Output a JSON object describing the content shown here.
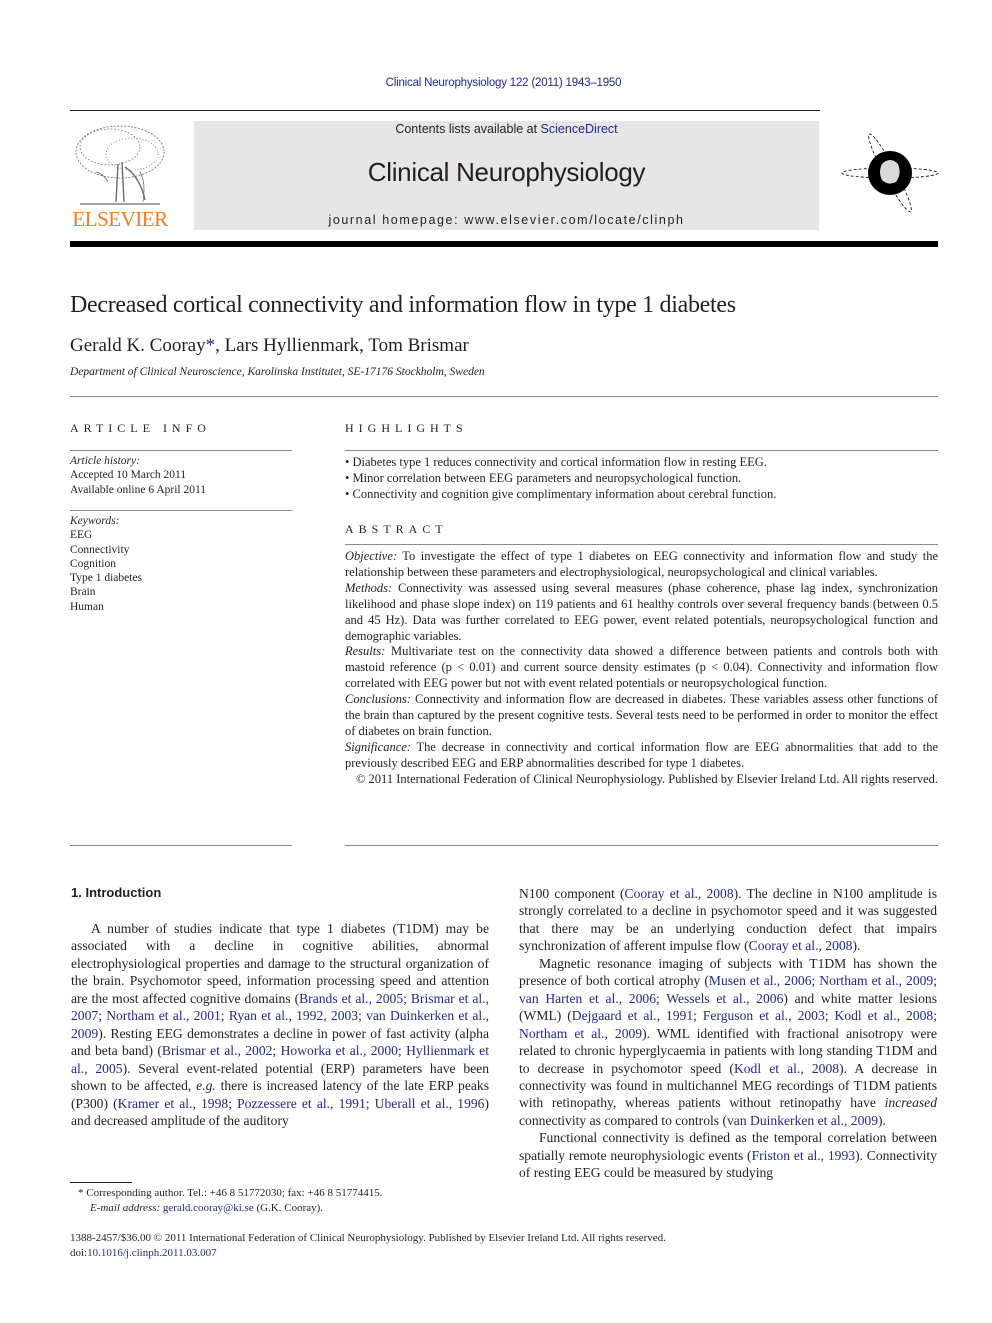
{
  "header": {
    "running_head": "Clinical Neurophysiology 122 (2011) 1943–1950",
    "contents_prefix": "Contents lists available at ",
    "contents_link": "ScienceDirect",
    "journal_title": "Clinical Neurophysiology",
    "homepage_line": "journal homepage: www.elsevier.com/locate/clinph",
    "publisher_logo_text": "ELSEVIER",
    "colors": {
      "link": "#1f2a8a",
      "elsevier_orange": "#f47b20",
      "masthead_bg": "#e6e6e6"
    }
  },
  "article": {
    "title": "Decreased cortical connectivity and information flow in type 1 diabetes",
    "authors": [
      {
        "name": "Gerald K. Cooray",
        "mark": "*"
      },
      {
        "name": "Lars Hyllienmark"
      },
      {
        "name": "Tom Brismar"
      }
    ],
    "authors_sep1": ", ",
    "authors_sep2": ", ",
    "affiliation": "Department of Clinical Neuroscience, Karolinska Institutet, SE-17176 Stockholm, Sweden"
  },
  "article_info": {
    "heading": "ARTICLE INFO",
    "history_label": "Article history:",
    "history": [
      "Accepted 10 March 2011",
      "Available online 6 April 2011"
    ],
    "keywords_label": "Keywords:",
    "keywords": [
      "EEG",
      "Connectivity",
      "Cognition",
      "Type 1 diabetes",
      "Brain",
      "Human"
    ]
  },
  "highlights": {
    "heading": "HIGHLIGHTS",
    "items": [
      "• Diabetes type 1 reduces connectivity and cortical information flow in resting EEG.",
      "• Minor correlation between EEG parameters and neuropsychological function.",
      "• Connectivity and cognition give complimentary information about cerebral function."
    ]
  },
  "abstract": {
    "heading": "ABSTRACT",
    "sections": [
      {
        "label": "Objective:",
        "text": " To investigate the effect of type 1 diabetes on EEG connectivity and information flow and study the relationship between these parameters and electrophysiological, neuropsychological and clinical variables."
      },
      {
        "label": "Methods:",
        "text": " Connectivity was assessed using several measures (phase coherence, phase lag index, synchronization likelihood and phase slope index) on 119 patients and 61 healthy controls over several frequency bands (between 0.5 and 45 Hz). Data was further correlated to EEG power, event related potentials, neuropsychological function and demographic variables."
      },
      {
        "label": "Results:",
        "text": " Multivariate test on the connectivity data showed a difference between patients and controls both with mastoid reference (p < 0.01) and current source density estimates (p < 0.04). Connectivity and information flow correlated with EEG power but not with event related potentials or neuropsychological function."
      },
      {
        "label": "Conclusions:",
        "text": " Connectivity and information flow are decreased in diabetes. These variables assess other functions of the brain than captured by the present cognitive tests. Several tests need to be performed in order to monitor the effect of diabetes on brain function."
      },
      {
        "label": "Significance:",
        "text": " The decrease in connectivity and cortical information flow are EEG abnormalities that add to the previously described EEG and ERP abnormalities described for type 1 diabetes."
      }
    ],
    "copyright": "© 2011 International Federation of Clinical Neurophysiology. Published by Elsevier Ireland Ltd. All rights reserved."
  },
  "body": {
    "section_heading": "1. Introduction",
    "left_col": {
      "p1": [
        {
          "t": "A number of studies indicate that type 1 diabetes (T1DM) may be associated with a decline in cognitive abilities, abnormal electrophysiological properties and damage to the structural organization of the brain. Psychomotor speed, information processing speed and attention are the most affected cognitive domains ("
        },
        {
          "link": "Brands et al., 2005; Brismar et al., 2007; Northam et al., 2001; Ryan et al., 1992, 2003; van Duinkerken et al., 2009"
        },
        {
          "t": "). Resting EEG demonstrates a decline in power of fast activity (alpha and beta band) ("
        },
        {
          "link": "Brismar et al., 2002; Howorka et al., 2000; Hyllienmark et al., 2005"
        },
        {
          "t": "). Several event-related potential (ERP) parameters have been shown to be affected, "
        },
        {
          "i": "e.g."
        },
        {
          "t": " there is increased latency of the late ERP peaks (P300) ("
        },
        {
          "link": "Kramer et al., 1998; Pozzessere et al., 1991; Uberall et al., 1996"
        },
        {
          "t": ") and decreased amplitude of the auditory"
        }
      ]
    },
    "right_col": {
      "p1": [
        {
          "t": "N100 component ("
        },
        {
          "link": "Cooray et al., 2008"
        },
        {
          "t": "). The decline in N100 amplitude is strongly correlated to a decline in psychomotor speed and it was suggested that there may be an underlying conduction defect that impairs synchronization of afferent impulse flow ("
        },
        {
          "link": "Cooray et al., 2008"
        },
        {
          "t": ")."
        }
      ],
      "p2": [
        {
          "t": "Magnetic resonance imaging of subjects with T1DM has shown the presence of both cortical atrophy ("
        },
        {
          "link": "Musen et al., 2006; Northam et al., 2009; van Harten et al., 2006; Wessels et al., 2006"
        },
        {
          "t": ") and white matter lesions (WML) ("
        },
        {
          "link": "Dejgaard et al., 1991; Ferguson et al., 2003; Kodl et al., 2008; Northam et al., 2009"
        },
        {
          "t": "). WML identified with fractional anisotropy were related to chronic hyperglycaemia in patients with long standing T1DM and to decrease in psychomotor speed ("
        },
        {
          "link": "Kodl et al., 2008"
        },
        {
          "t": "). A decrease in connectivity was found in multichannel MEG recordings of T1DM patients with retinopathy, whereas patients without retinopathy have "
        },
        {
          "i": "increased"
        },
        {
          "t": " connectivity as compared to controls ("
        },
        {
          "link": "van Duinkerken et al., 2009"
        },
        {
          "t": ")."
        }
      ],
      "p3": [
        {
          "t": "Functional connectivity is defined as the temporal correlation between spatially remote neurophysiologic events ("
        },
        {
          "link": "Friston et al., 1993"
        },
        {
          "t": "). Connectivity of resting EEG could be measured by studying"
        }
      ]
    }
  },
  "footnote": {
    "mark": "*",
    "corresponding": " Corresponding author. Tel.: +46 8 51772030; fax: +46 8 51774415.",
    "email_label": "E-mail address:",
    "email": "gerald.cooray@ki.se",
    "email_suffix": " (G.K. Cooray)."
  },
  "bottom": {
    "issn_line": "1388-2457/$36.00 © 2011 International Federation of Clinical Neurophysiology. Published by Elsevier Ireland Ltd. All rights reserved.",
    "doi_prefix": "doi:",
    "doi": "10.1016/j.clinph.2011.03.007"
  }
}
